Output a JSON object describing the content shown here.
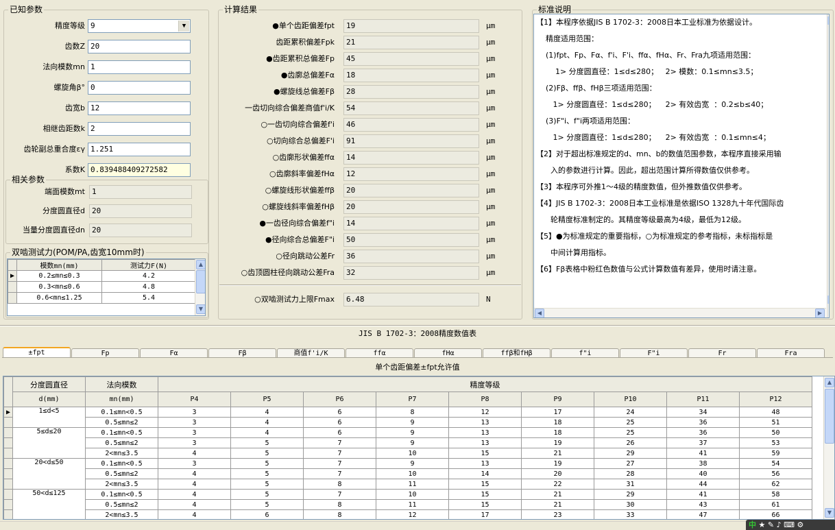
{
  "known": {
    "title": "已知参数",
    "fields": [
      {
        "label": "精度等级",
        "value": "9",
        "type": "select"
      },
      {
        "label": "齿数Z",
        "value": "20"
      },
      {
        "label": "法向模数mn",
        "value": "1"
      },
      {
        "label": "螺旋角β°",
        "value": "0"
      },
      {
        "label": "齿宽b",
        "value": "12"
      },
      {
        "label": "相继齿距数k",
        "value": "2"
      },
      {
        "label": "齿轮副总重合度εγ",
        "value": "1.251"
      },
      {
        "label": "系数K",
        "value": "0.839488409272582"
      }
    ],
    "related_title": "相关参数",
    "related": [
      {
        "label": "端面模数mt",
        "value": "1"
      },
      {
        "label": "分度圆直径d",
        "value": "20"
      },
      {
        "label": "当量分度圆直径dn",
        "value": "20"
      }
    ],
    "force_title": "双啮测试力(POM/PA,齿宽10mm时)",
    "force_headers": [
      "模数mn(mm)",
      "测试力F(N)"
    ],
    "force_rows": [
      [
        "0.2≤mn≤0.3",
        "4.2"
      ],
      [
        "0.3<mn≤0.6",
        "4.8"
      ],
      [
        "0.6<mn≤1.25",
        "5.4"
      ]
    ]
  },
  "results": {
    "title": "计算结果",
    "unit": "μm",
    "rows": [
      {
        "label": "●单个齿距偏差fpt",
        "value": "19",
        "unit": "μm"
      },
      {
        "label": "齿距累积偏差Fpk",
        "value": "21",
        "unit": "μm"
      },
      {
        "label": "●齿距累积总偏差Fp",
        "value": "45",
        "unit": "μm"
      },
      {
        "label": "●齿廓总偏差Fα",
        "value": "18",
        "unit": "μm"
      },
      {
        "label": "●螺旋线总偏差Fβ",
        "value": "28",
        "unit": "μm"
      },
      {
        "label": "一齿切向综合偏差商值f'i/K",
        "value": "54",
        "unit": "μm"
      },
      {
        "label": "○一齿切向综合偏差f'i",
        "value": "46",
        "unit": "μm"
      },
      {
        "label": "○切向综合总偏差F'i",
        "value": "91",
        "unit": "μm"
      },
      {
        "label": "○齿廓形状偏差ffα",
        "value": "14",
        "unit": "μm"
      },
      {
        "label": "○齿廓斜率偏差fHα",
        "value": "12",
        "unit": "μm"
      },
      {
        "label": "○螺旋线形状偏差ffβ",
        "value": "20",
        "unit": "μm"
      },
      {
        "label": "○螺旋线斜率偏差fHβ",
        "value": "20",
        "unit": "μm"
      },
      {
        "label": "●一齿径向综合偏差f\"i",
        "value": "14",
        "unit": "μm"
      },
      {
        "label": "●径向综合总偏差F\"i",
        "value": "50",
        "unit": "μm"
      },
      {
        "label": "○径向跳动公差Fr",
        "value": "36",
        "unit": "μm"
      },
      {
        "label": "○齿顶圆柱径向跳动公差Fra",
        "value": "32",
        "unit": "μm"
      }
    ],
    "force": {
      "label": "○双啮测试力上限Fmax",
      "value": "6.48",
      "unit": "N"
    }
  },
  "notes": {
    "title": "标准说明",
    "lines": [
      "【1】本程序依据JIS B 1702-3：2008日本工业标准为依据设计。",
      "    精度适用范围：",
      "    (1)fpt、Fp、Fα、f'i、F'i、ffα、fHα、Fr、Fra九项适用范围：",
      "        1> 分度圆直径：1≤d≤280；   2> 模数：0.1≤mn≤3.5；",
      "    (2)Fβ、ffβ、fHβ三项适用范围：",
      "       1> 分度圆直径：1≤d≤280；    2> 有效齿宽  ：0.2≤b≤40；",
      "    (3)F\"i、f\"i两项适用范围：",
      "       1> 分度圆直径：1≤d≤280；    2> 有效齿宽  ：0.1≤mn≤4；",
      "【2】对于超出标准规定的d、mn、b的数值范围参数，本程序直接采用输",
      "      入的参数进行计算。因此，超出范围计算所得数值仅供参考。",
      "【3】本程序可外推1～4级的精度数值，但外推数值仅供参考。",
      "【4】JIS B 1702-3：2008日本工业标准是依据ISO 1328九十年代国际齿",
      "      轮精度标准制定的。其精度等级最高为4级，最低为12级。",
      "【5】●为标准规定的重要指标，○为标准规定的参考指标，未标指标是",
      "      中间计算用指标。",
      "【6】Fβ表格中粉红色数值与公式计算数值有差异，使用时请注意。"
    ]
  },
  "table_title": "JIS B 1702-3：2008精度数值表",
  "tabs": [
    "±fpt",
    "Fp",
    "Fα",
    "Fβ",
    "商值f'i/K",
    "ffα",
    "fHα",
    "ffβ和fHβ",
    "f\"i",
    "F\"i",
    "Fr",
    "Fra"
  ],
  "active_tab": "±fpt",
  "grid": {
    "caption": "单个齿距偏差±fpt允许值",
    "h_diam": "分度圆直径",
    "h_mod": "法向模数",
    "h_grade": "精度等级",
    "h_diam_unit": "d(mm)",
    "h_mod_unit": "mn(mm)",
    "grades": [
      "P4",
      "P5",
      "P6",
      "P7",
      "P8",
      "P9",
      "P10",
      "P11",
      "P12"
    ],
    "groups": [
      {
        "diam": "1≤d<5",
        "rows": [
          {
            "mod": "0.1≤mn<0.5",
            "vals": [
              "3",
              "4",
              "6",
              "8",
              "12",
              "17",
              "24",
              "34",
              "48"
            ]
          },
          {
            "mod": "0.5≤mn≤2",
            "vals": [
              "3",
              "4",
              "6",
              "9",
              "13",
              "18",
              "25",
              "36",
              "51"
            ]
          }
        ]
      },
      {
        "diam": "5≤d≤20",
        "rows": [
          {
            "mod": "0.1≤mn<0.5",
            "vals": [
              "3",
              "4",
              "6",
              "9",
              "13",
              "18",
              "25",
              "36",
              "50"
            ]
          },
          {
            "mod": "0.5≤mn≤2",
            "vals": [
              "3",
              "5",
              "7",
              "9",
              "13",
              "19",
              "26",
              "37",
              "53"
            ]
          },
          {
            "mod": "2<mn≤3.5",
            "vals": [
              "4",
              "5",
              "7",
              "10",
              "15",
              "21",
              "29",
              "41",
              "59"
            ]
          }
        ]
      },
      {
        "diam": "20<d≤50",
        "rows": [
          {
            "mod": "0.1≤mn<0.5",
            "vals": [
              "3",
              "5",
              "7",
              "9",
              "13",
              "19",
              "27",
              "38",
              "54"
            ]
          },
          {
            "mod": "0.5≤mn≤2",
            "vals": [
              "4",
              "5",
              "7",
              "10",
              "14",
              "20",
              "28",
              "40",
              "56"
            ]
          },
          {
            "mod": "2<mn≤3.5",
            "vals": [
              "4",
              "5",
              "8",
              "11",
              "15",
              "22",
              "31",
              "44",
              "62"
            ]
          }
        ]
      },
      {
        "diam": "50<d≤125",
        "rows": [
          {
            "mod": "0.1≤mn<0.5",
            "vals": [
              "4",
              "5",
              "7",
              "10",
              "15",
              "21",
              "29",
              "41",
              "58"
            ]
          },
          {
            "mod": "0.5≤mn≤2",
            "vals": [
              "4",
              "5",
              "8",
              "11",
              "15",
              "21",
              "30",
              "43",
              "61"
            ]
          },
          {
            "mod": "2<mn≤3.5",
            "vals": [
              "4",
              "6",
              "8",
              "12",
              "17",
              "23",
              "33",
              "47",
              "66"
            ]
          }
        ]
      }
    ]
  },
  "tray": {
    "ime": "中"
  },
  "colors": {
    "panel": "#ece9d8",
    "tab_accent": "#f3a520",
    "field_border": "#7f9db9",
    "k_field": "#ffffe1"
  }
}
